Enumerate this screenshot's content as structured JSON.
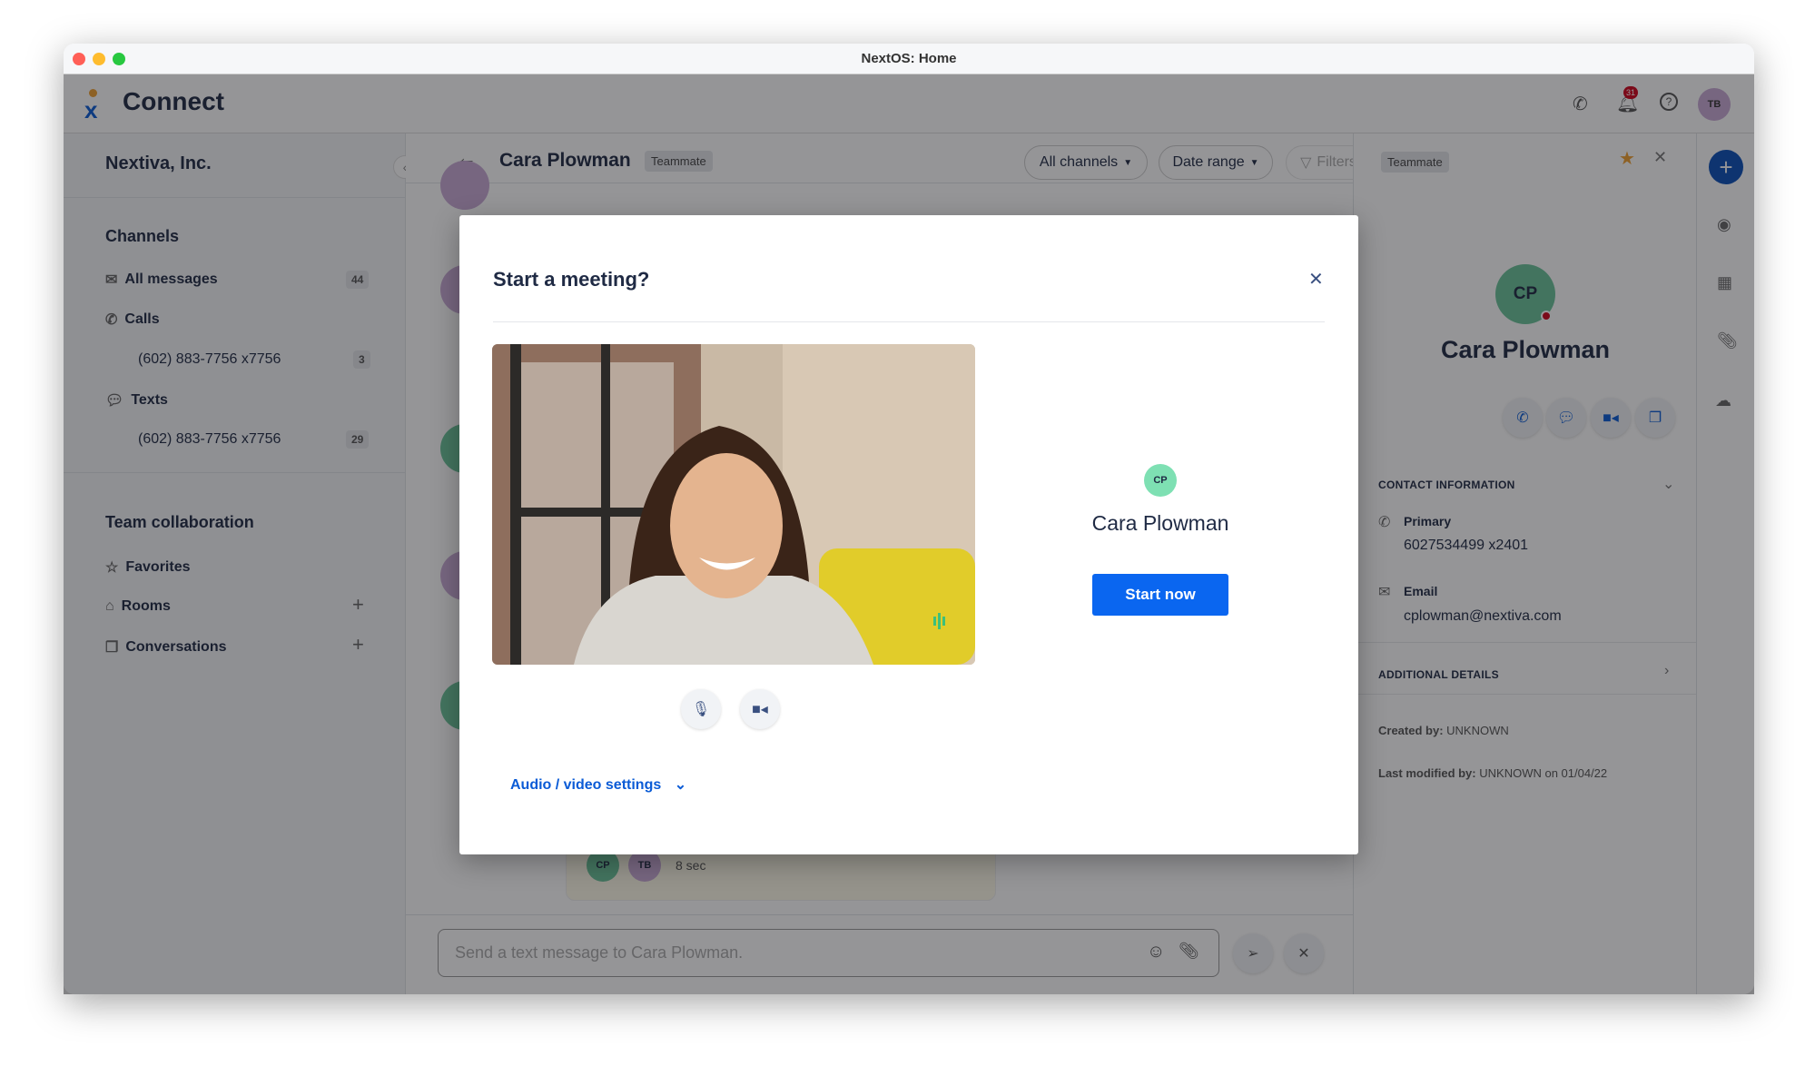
{
  "window": {
    "title": "NextOS: Home"
  },
  "header": {
    "app_name": "Connect",
    "notification_count": "31",
    "user_initials": "TB"
  },
  "sidebar": {
    "org": "Nextiva, Inc.",
    "channels_heading": "Channels",
    "channels": [
      {
        "label": "All messages",
        "count": "44",
        "icon": "inbox-icon"
      },
      {
        "label": "Calls",
        "icon": "phone-icon"
      },
      {
        "label": "(602) 883-7756 x7756",
        "count": "3"
      },
      {
        "label": "Texts",
        "icon": "chat-bubble-icon"
      },
      {
        "label": "(602) 883-7756 x7756",
        "count": "29"
      }
    ],
    "team_heading": "Team collaboration",
    "team": [
      {
        "label": "Favorites",
        "icon": "star-icon"
      },
      {
        "label": "Rooms",
        "icon": "building-icon"
      },
      {
        "label": "Conversations",
        "icon": "conversations-icon"
      }
    ]
  },
  "chat": {
    "contact_name": "Cara Plowman",
    "contact_badge": "Teammate",
    "filters": {
      "channels": "All channels",
      "date": "Date range",
      "filters": "Filters"
    },
    "bubble": {
      "avatars": [
        "CP",
        "TB"
      ],
      "duration": "8 sec"
    },
    "input_placeholder": "Send a text message to Cara Plowman."
  },
  "contact_panel": {
    "badge": "Teammate",
    "initials": "CP",
    "name": "Cara Plowman",
    "contact_heading": "CONTACT INFORMATION",
    "primary_label": "Primary",
    "primary_value": "6027534499 x2401",
    "email_label": "Email",
    "email_value": "cplowman@nextiva.com",
    "additional_heading": "ADDITIONAL DETAILS",
    "created_label": "Created by:",
    "created_value": "UNKNOWN",
    "modified_label": "Last modified by:",
    "modified_value": "UNKNOWN on 01/04/22"
  },
  "modal": {
    "title": "Start a meeting?",
    "participant_initials": "CP",
    "participant_name": "Cara Plowman",
    "start_label": "Start now",
    "settings_label": "Audio / video settings"
  },
  "colors": {
    "accent": "#0a5bd6",
    "avatar_cp": "#6bc49a",
    "avatar_tb": "#c8a9d6",
    "star": "#f0a030",
    "status_red": "#d0021b"
  }
}
